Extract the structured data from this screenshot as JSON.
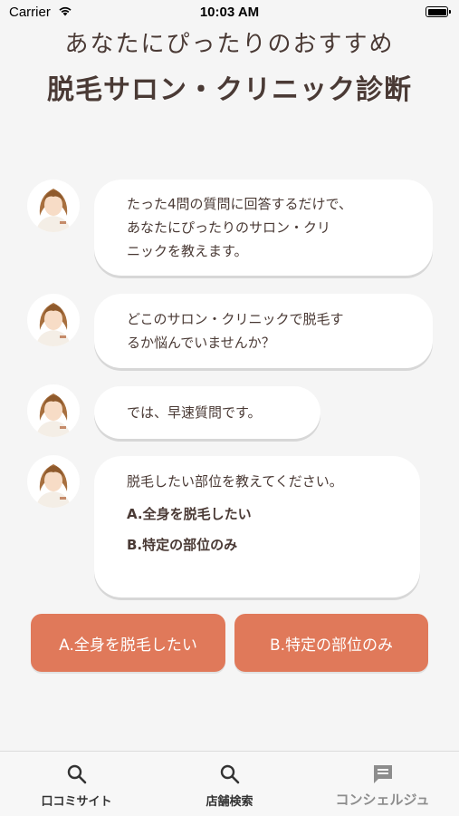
{
  "status_bar": {
    "carrier": "Carrier",
    "time": "10:03 AM"
  },
  "header": {
    "subtitle": "あなたにぴったりのおすすめ",
    "title": "脱毛サロン・クリニック診断"
  },
  "messages": [
    {
      "lines": [
        "たった4問の質問に回答するだけで、",
        "あなたにぴったりのサロン・クリ",
        "ニックを教えます。"
      ]
    },
    {
      "lines": [
        "どこのサロン・クリニックで脱毛す",
        "るか悩んでいませんか？"
      ]
    },
    {
      "lines": [
        "では、早速質問です。"
      ]
    },
    {
      "lines": [
        "脱毛したい部位を教えてください。"
      ],
      "options": [
        "A.全身を脱毛したい",
        "B.特定の部位のみ"
      ]
    }
  ],
  "answers": {
    "a": "A.全身を脱毛したい",
    "b": "B.特定の部位のみ"
  },
  "tabs": [
    {
      "label": "口コミサイト",
      "icon": "search-icon"
    },
    {
      "label": "店舗検索",
      "icon": "search-icon"
    },
    {
      "label": "コンシェルジュ",
      "icon": "chat-icon"
    }
  ],
  "colors": {
    "accent": "#e0795a",
    "text": "#4a3a35",
    "background": "#f5f5f5"
  }
}
